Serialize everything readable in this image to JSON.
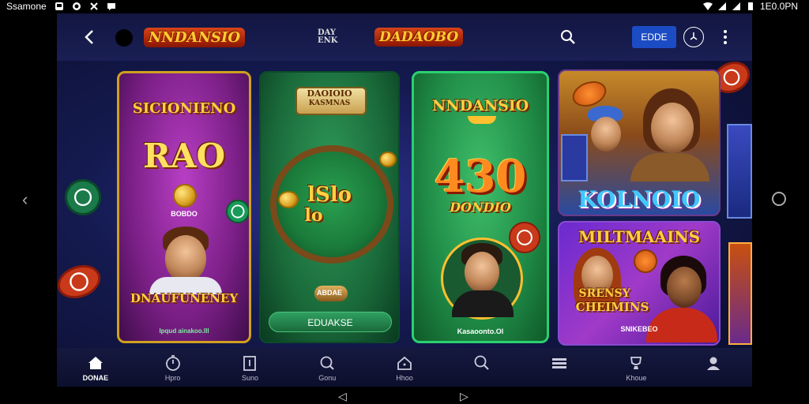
{
  "status_bar": {
    "carrier": "Ssamone",
    "time": "1E0.0PN"
  },
  "header": {
    "logo_left": "NNDANSIO",
    "logo_mid_line1": "DAY",
    "logo_mid_line2": "ENK",
    "logo_right": "DADAOBO",
    "mode_button": "EDDE"
  },
  "cards": [
    {
      "title": "SICIONIENO",
      "headline": "RAO",
      "badge": "BOBDO",
      "banner": "DNAUFUNENEY",
      "footer": "Ipqud ainakoo.lll"
    },
    {
      "title_line1": "DAOIOIO",
      "title_line2": "KASMNAS",
      "table_text": "lSlo",
      "table_text2": "lo",
      "badge": "ABDAE",
      "button": "EDUAKSE"
    },
    {
      "title": "NNDANSIO",
      "headline": "430",
      "subheadline": "DONDIO",
      "footer": "Kasaoonto.Ol"
    },
    {
      "title": "KOLNOIO"
    },
    {
      "title": "MILTMAAINS",
      "banner_line1": "SRENSY",
      "banner_line2": "CHEIMINS",
      "footer": "SNIKEBEO"
    }
  ],
  "bottom_nav": [
    {
      "label": "DONAE",
      "icon": "home-icon",
      "active": true
    },
    {
      "label": "Hpro",
      "icon": "timer-icon",
      "active": false
    },
    {
      "label": "Suno",
      "icon": "clipboard-icon",
      "active": false
    },
    {
      "label": "Gonu",
      "icon": "search-icon",
      "active": false
    },
    {
      "label": "Hhoo",
      "icon": "house-icon",
      "active": false
    },
    {
      "label": "",
      "icon": "search-icon",
      "active": false
    },
    {
      "label": "",
      "icon": "list-icon",
      "active": false
    },
    {
      "label": "Khoue",
      "icon": "trophy-icon",
      "active": false
    },
    {
      "label": "",
      "icon": "user-icon",
      "active": false
    }
  ],
  "colors": {
    "accent_blue": "#1c4cc4",
    "gold": "#ffd040",
    "background": "#141a4e"
  }
}
